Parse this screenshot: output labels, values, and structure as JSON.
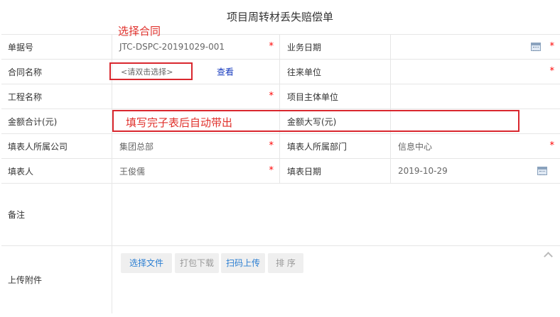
{
  "title": "项目周转材丢失赔偿单",
  "annotations": {
    "select_contract": "选择合同",
    "auto_fill": "填写完子表后自动带出"
  },
  "form": {
    "row1": {
      "label1": "单据号",
      "value1": "JTC-DSPC-20191029-001",
      "label2": "业务日期",
      "value2": ""
    },
    "row2": {
      "label1": "合同名称",
      "placeholder": "<请双击选择>",
      "view_link": "查看",
      "label2": "往来单位",
      "value2": ""
    },
    "row3": {
      "label1": "工程名称",
      "value1": "",
      "label2": "项目主体单位",
      "value2": ""
    },
    "row4": {
      "label1": "金额合计(元)",
      "value1": "",
      "label2": "金额大写(元)",
      "value2": ""
    },
    "row5": {
      "label1": "填表人所属公司",
      "value1": "集团总部",
      "label2": "填表人所属部门",
      "value2": "信息中心"
    },
    "row6": {
      "label1": "填表人",
      "value1": "王俊儒",
      "label2": "填表日期",
      "value2": "2019-10-29"
    },
    "remarks": {
      "label": "备注",
      "value": ""
    },
    "attachments": {
      "label": "上传附件",
      "buttons": [
        "选择文件",
        "打包下载",
        "扫码上传",
        "排 序"
      ]
    }
  },
  "required_mark": "*",
  "colors": {
    "required": "#ff0000",
    "annotation": "#e0302b",
    "link": "#1a3dbf",
    "button_blue": "#2a7ed2"
  },
  "icons": {
    "calendar": "calendar-icon",
    "collapse": "chevron-up-icon"
  }
}
